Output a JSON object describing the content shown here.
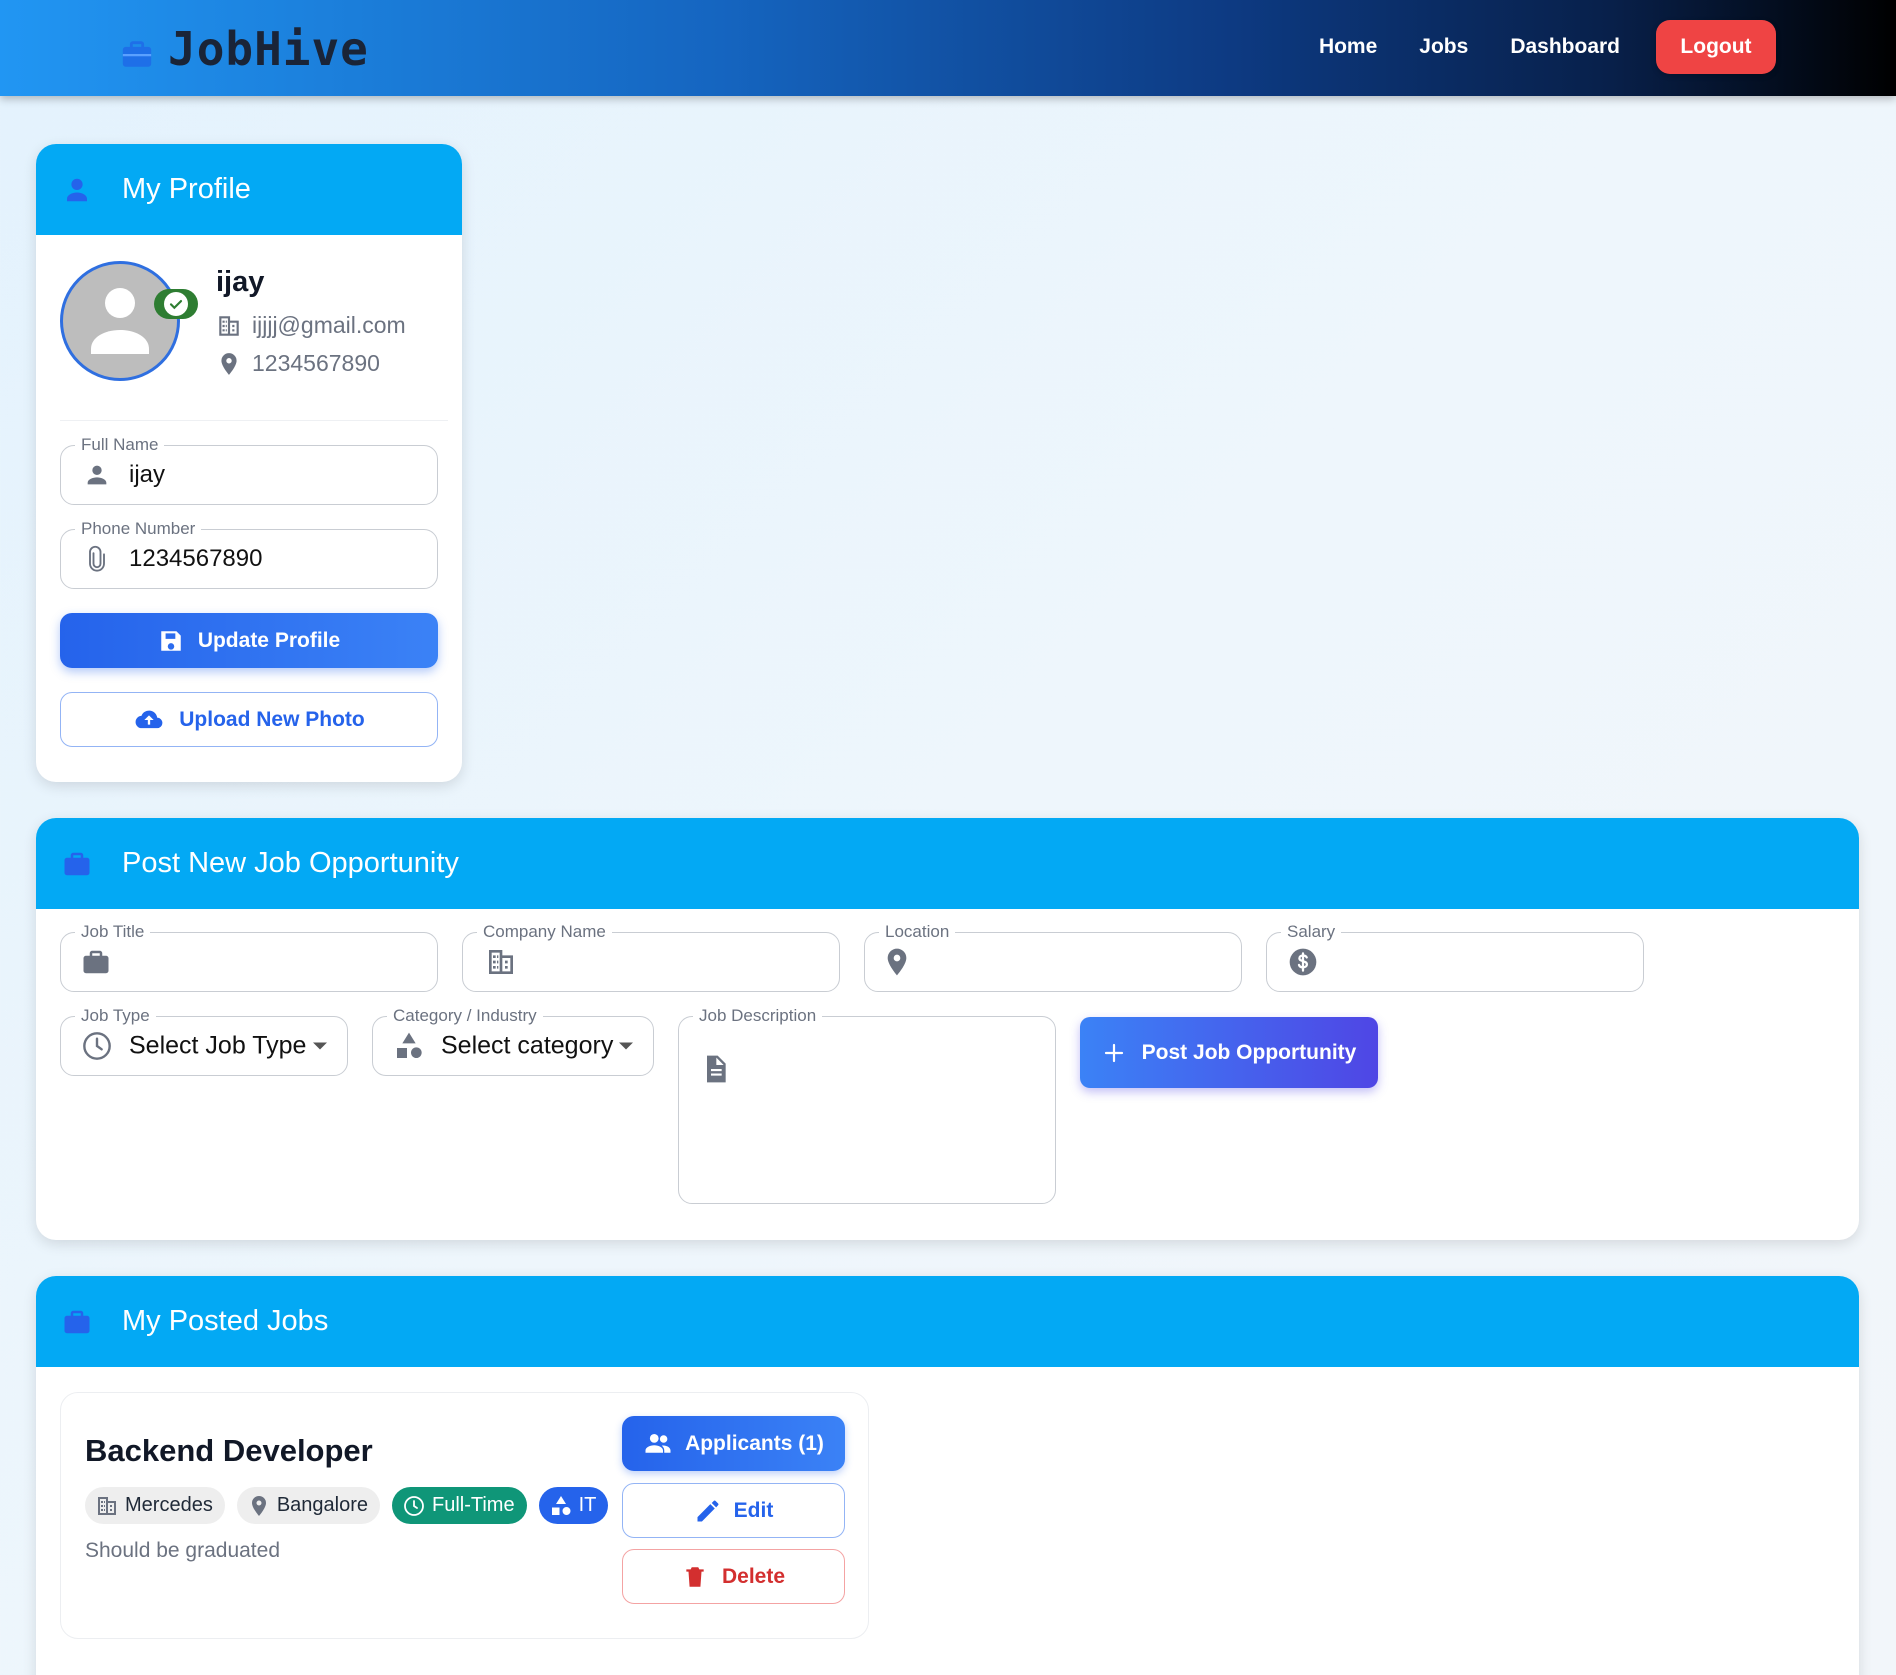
{
  "navbar": {
    "brand": "JobHive",
    "brand_icon": "briefcase-icon",
    "links": [
      "Home",
      "Jobs",
      "Dashboard"
    ],
    "logout_label": "Logout",
    "logout_color": "#ef4444"
  },
  "profile": {
    "section_title": "My Profile",
    "name": "ijay",
    "email": "ijjjj@gmail.com",
    "phone": "1234567890",
    "verified_icon": "check-circle-icon",
    "full_name_label": "Full Name",
    "full_name_value": "ijay",
    "phone_label": "Phone Number",
    "phone_value": "1234567890",
    "update_button": "Update Profile",
    "upload_button": "Upload New Photo"
  },
  "post_job": {
    "section_title": "Post New Job Opportunity",
    "job_title_label": "Job Title",
    "company_label": "Company Name",
    "location_label": "Location",
    "salary_label": "Salary",
    "job_type_label": "Job Type",
    "job_type_value": "Select Job Type",
    "category_label": "Category / Industry",
    "category_value": "Select category",
    "description_label": "Job Description",
    "submit_button": "Post Job Opportunity"
  },
  "posted_jobs": {
    "section_title": "My Posted Jobs",
    "jobs": [
      {
        "title": "Backend Developer",
        "company": "Mercedes",
        "location": "Bangalore",
        "type": "Full-Time",
        "category": "IT",
        "description": "Should be graduated",
        "applicants_button": "Applicants (1)",
        "edit_button": "Edit",
        "delete_button": "Delete"
      }
    ]
  },
  "colors": {
    "header_blue": "#03a9f4",
    "primary": "#2563eb",
    "danger": "#d32f2f",
    "chip_green": "#0f9678"
  }
}
